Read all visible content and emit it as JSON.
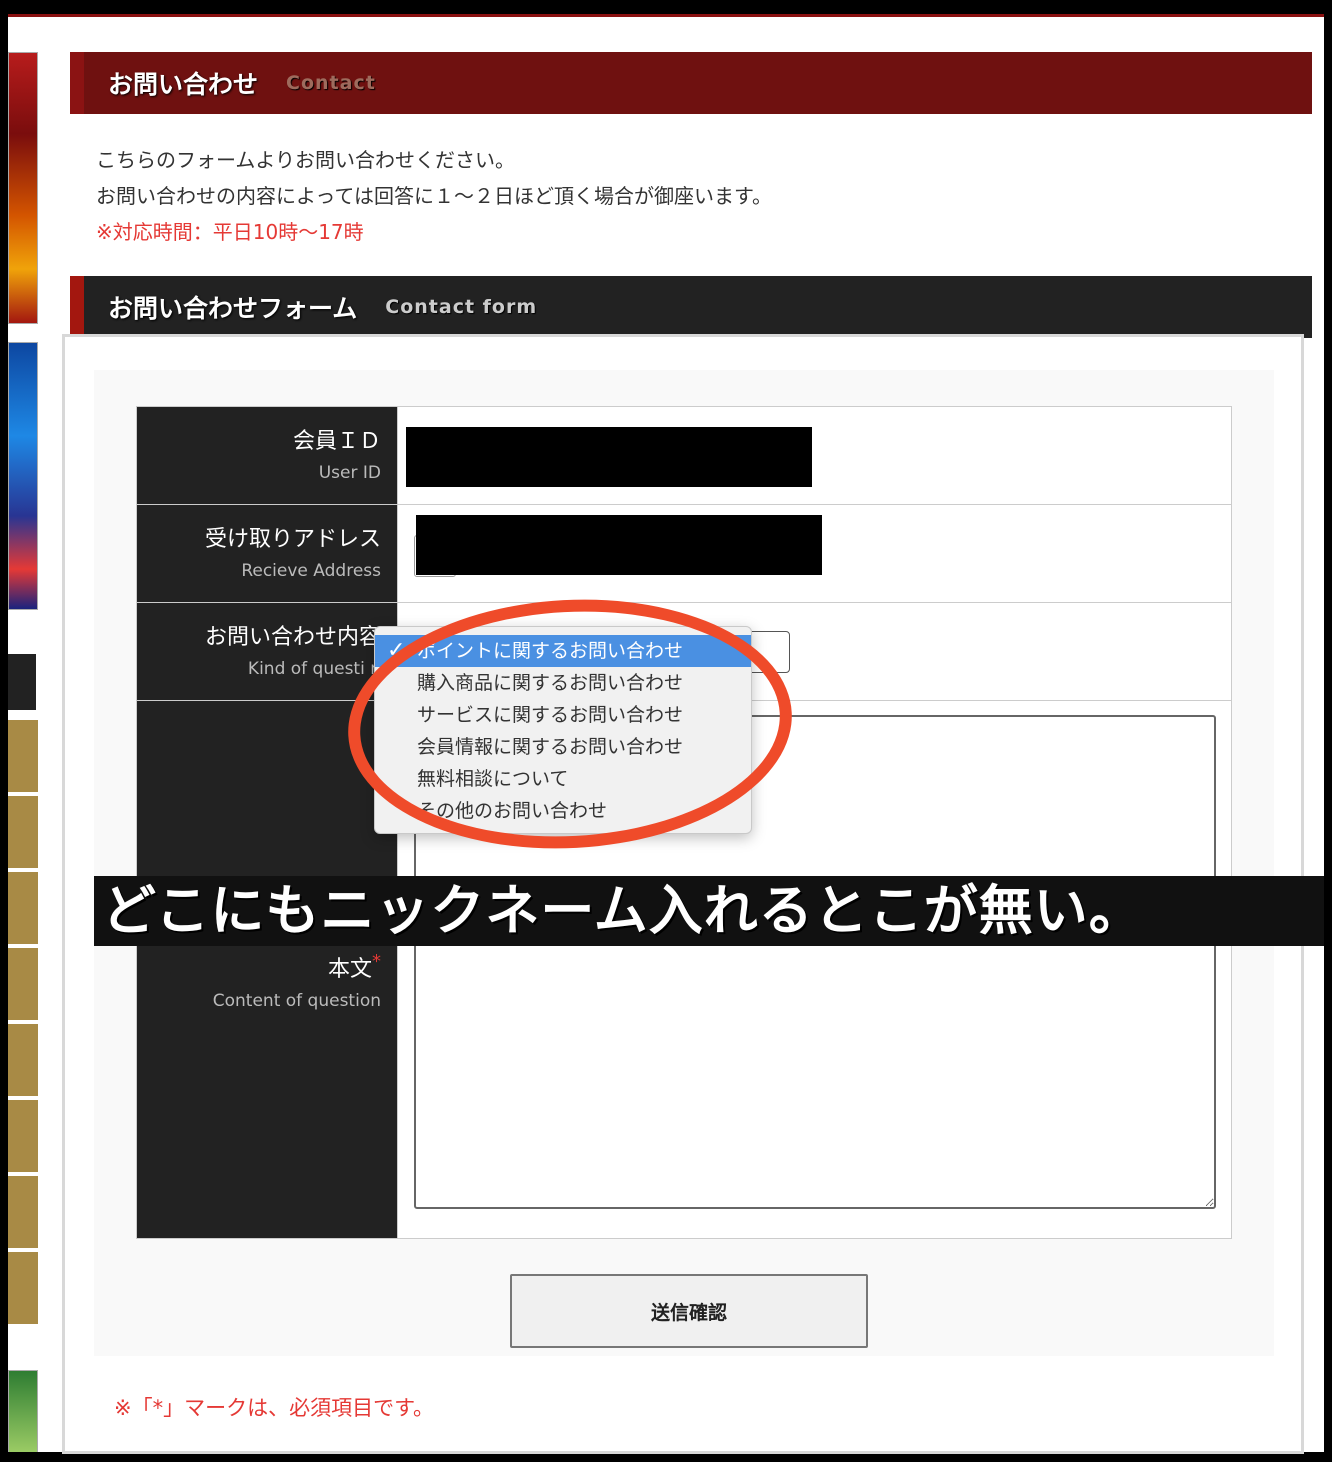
{
  "section1": {
    "title": "お問い合わせ",
    "subtitle": "Contact"
  },
  "intro": {
    "line1": "こちらのフォームよりお問い合わせください。",
    "line2": "お問い合わせの内容によっては回答に１～２日ほど頂く場合が御座います。",
    "note": "※対応時間：平日10時～17時"
  },
  "section2": {
    "title": "お問い合わせフォーム",
    "subtitle": "Contact form"
  },
  "form": {
    "user_id": {
      "label_jp": "会員ＩＤ",
      "label_en": "User ID"
    },
    "address": {
      "label_jp": "受け取りアドレス",
      "label_en": "Recieve Address"
    },
    "kind": {
      "label_jp": "お問い合わせ内容",
      "label_en": "Kind of questi n"
    },
    "body": {
      "label_jp": "本文",
      "required_mark": "*",
      "label_en": "Content of question"
    },
    "submit_label": "送信確認"
  },
  "dropdown": {
    "check_mark": "✓",
    "options": [
      "ポイントに関するお問い合わせ",
      "購入商品に関するお問い合わせ",
      "サービスに関するお問い合わせ",
      "会員情報に関するお問い合わせ",
      "無料相談について",
      "その他のお問い合わせ"
    ],
    "selected_index": 0
  },
  "caption": "どこにもニックネーム入れるとこが無い。",
  "footnote": "※「*」マークは、必須項目です。",
  "colors": {
    "header_red": "#6f1110",
    "header_dark": "#222222",
    "accent_red": "#e53935",
    "annotation": "#ef4b2a",
    "highlight": "#4a90e2"
  }
}
